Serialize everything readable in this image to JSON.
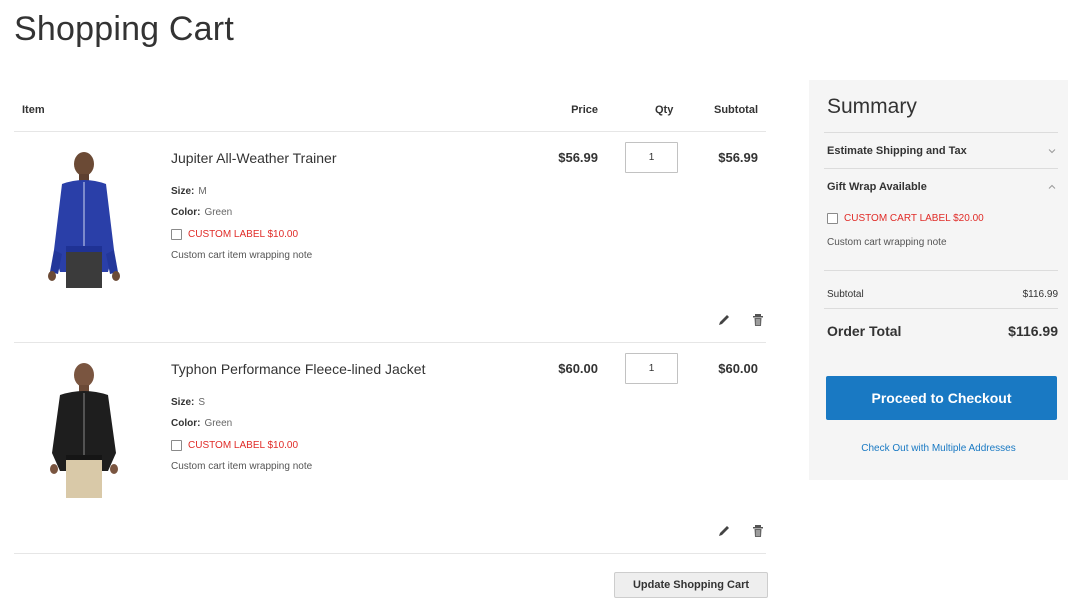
{
  "page": {
    "title": "Shopping Cart"
  },
  "colors": {
    "accent": "#1979c3",
    "label_red": "#e02b27",
    "summary_bg": "#f5f5f5"
  },
  "cart": {
    "headers": {
      "item": "Item",
      "price": "Price",
      "qty": "Qty",
      "subtotal": "Subtotal"
    },
    "items": [
      {
        "name": "Jupiter All-Weather Trainer",
        "size_label": "Size:",
        "size": "M",
        "color_label": "Color:",
        "color": "Green",
        "custom_label": "CUSTOM LABEL $10.00",
        "note": "Custom cart item wrapping note",
        "price": "$56.99",
        "qty": "1",
        "subtotal": "$56.99",
        "image": "blue-jacket-photo"
      },
      {
        "name": "Typhon Performance Fleece-lined Jacket",
        "size_label": "Size:",
        "size": "S",
        "color_label": "Color:",
        "color": "Green",
        "custom_label": "CUSTOM LABEL $10.00",
        "note": "Custom cart item wrapping note",
        "price": "$60.00",
        "qty": "1",
        "subtotal": "$60.00",
        "image": "black-jacket-photo"
      }
    ],
    "update_button": "Update Shopping Cart"
  },
  "summary": {
    "title": "Summary",
    "estimate_shipping": "Estimate Shipping and Tax",
    "gift_wrap": "Gift Wrap Available",
    "gift_label": "CUSTOM CART LABEL $20.00",
    "gift_note": "Custom cart wrapping note",
    "subtotal_label": "Subtotal",
    "subtotal_value": "$116.99",
    "order_total_label": "Order Total",
    "order_total_value": "$116.99",
    "checkout_button": "Proceed to Checkout",
    "multi_address_link": "Check Out with Multiple Addresses"
  }
}
